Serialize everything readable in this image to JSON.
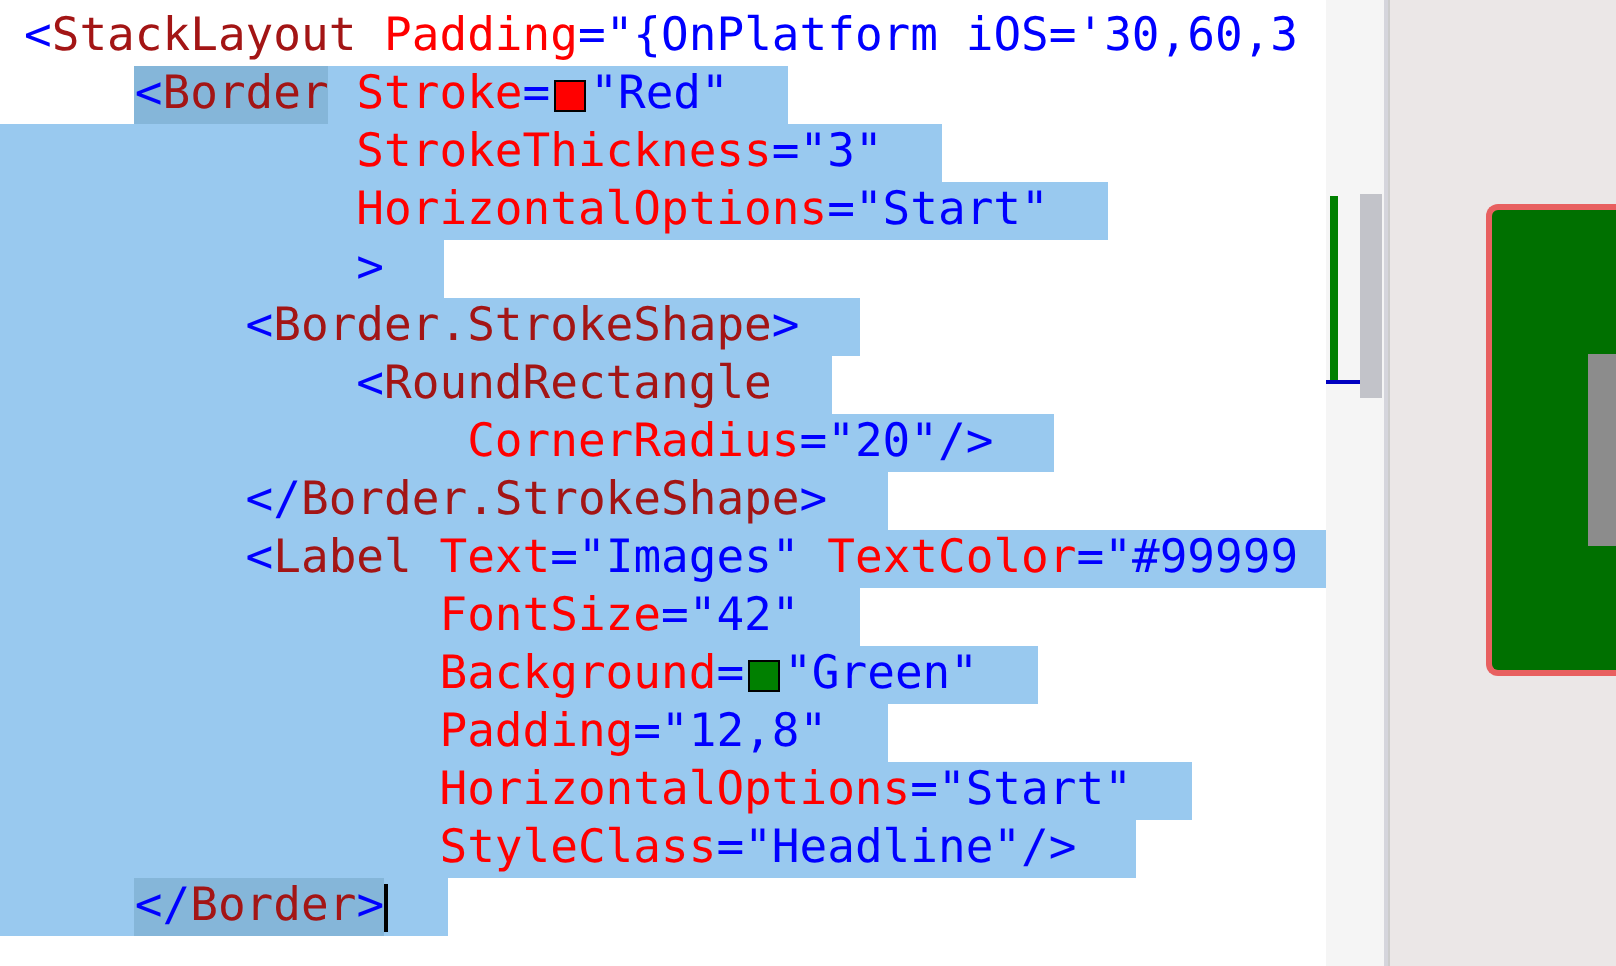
{
  "editor": {
    "lines": [
      {
        "selected": false,
        "tokens": [
          {
            "kind": "punct",
            "text": "<"
          },
          {
            "kind": "tag",
            "text": "StackLayout"
          },
          {
            "kind": "attr",
            "text": " Padding"
          },
          {
            "kind": "punct",
            "text": "="
          },
          {
            "kind": "value",
            "text": "\"{OnPlatform iOS='30,60,3"
          }
        ]
      },
      {
        "selected": true,
        "indent_selected": false,
        "tokens": [
          {
            "kind": "punct",
            "text": "    <",
            "matched": true
          },
          {
            "kind": "tag",
            "text": "Border",
            "matched": true
          },
          {
            "kind": "attr",
            "text": " Stroke"
          },
          {
            "kind": "punct",
            "text": "="
          },
          {
            "kind": "swatch",
            "color": "#ff0000"
          },
          {
            "kind": "value",
            "text": "\"Red\""
          }
        ]
      },
      {
        "selected": true,
        "indent_selected": true,
        "tokens": [
          {
            "kind": "attr",
            "text": "            StrokeThickness"
          },
          {
            "kind": "punct",
            "text": "="
          },
          {
            "kind": "value",
            "text": "\"3\""
          }
        ]
      },
      {
        "selected": true,
        "indent_selected": true,
        "tokens": [
          {
            "kind": "attr",
            "text": "            HorizontalOptions"
          },
          {
            "kind": "punct",
            "text": "="
          },
          {
            "kind": "value",
            "text": "\"Start\""
          }
        ]
      },
      {
        "selected": true,
        "indent_selected": true,
        "tokens": [
          {
            "kind": "punct",
            "text": "            >"
          }
        ]
      },
      {
        "selected": true,
        "indent_selected": true,
        "tokens": [
          {
            "kind": "punct",
            "text": "        <"
          },
          {
            "kind": "tag",
            "text": "Border.StrokeShape"
          },
          {
            "kind": "punct",
            "text": ">"
          }
        ]
      },
      {
        "selected": true,
        "indent_selected": true,
        "tokens": [
          {
            "kind": "punct",
            "text": "            <"
          },
          {
            "kind": "tag",
            "text": "RoundRectangle"
          }
        ]
      },
      {
        "selected": true,
        "indent_selected": true,
        "tokens": [
          {
            "kind": "attr",
            "text": "                CornerRadius"
          },
          {
            "kind": "punct",
            "text": "="
          },
          {
            "kind": "value",
            "text": "\"20\""
          },
          {
            "kind": "punct",
            "text": "/>"
          }
        ]
      },
      {
        "selected": true,
        "indent_selected": true,
        "tokens": [
          {
            "kind": "punct",
            "text": "        </"
          },
          {
            "kind": "tag",
            "text": "Border.StrokeShape"
          },
          {
            "kind": "punct",
            "text": ">"
          }
        ]
      },
      {
        "selected": true,
        "indent_selected": true,
        "tokens": [
          {
            "kind": "punct",
            "text": "        <"
          },
          {
            "kind": "tag",
            "text": "Label"
          },
          {
            "kind": "attr",
            "text": " Text"
          },
          {
            "kind": "punct",
            "text": "="
          },
          {
            "kind": "value",
            "text": "\"Images\""
          },
          {
            "kind": "attr",
            "text": " TextColor"
          },
          {
            "kind": "punct",
            "text": "="
          },
          {
            "kind": "value",
            "text": "\"#99999"
          }
        ]
      },
      {
        "selected": true,
        "indent_selected": true,
        "tokens": [
          {
            "kind": "attr",
            "text": "               FontSize"
          },
          {
            "kind": "punct",
            "text": "="
          },
          {
            "kind": "value",
            "text": "\"42\""
          }
        ]
      },
      {
        "selected": true,
        "indent_selected": true,
        "tokens": [
          {
            "kind": "attr",
            "text": "               Background"
          },
          {
            "kind": "punct",
            "text": "="
          },
          {
            "kind": "swatch",
            "color": "#008000"
          },
          {
            "kind": "value",
            "text": "\"Green\""
          }
        ]
      },
      {
        "selected": true,
        "indent_selected": true,
        "tokens": [
          {
            "kind": "attr",
            "text": "               Padding"
          },
          {
            "kind": "punct",
            "text": "="
          },
          {
            "kind": "value",
            "text": "\"12,8\""
          }
        ]
      },
      {
        "selected": true,
        "indent_selected": true,
        "tokens": [
          {
            "kind": "attr",
            "text": "               HorizontalOptions"
          },
          {
            "kind": "punct",
            "text": "="
          },
          {
            "kind": "value",
            "text": "\"Start\""
          }
        ]
      },
      {
        "selected": true,
        "indent_selected": true,
        "tokens": [
          {
            "kind": "attr",
            "text": "               StyleClass"
          },
          {
            "kind": "punct",
            "text": "="
          },
          {
            "kind": "value",
            "text": "\"Headline\""
          },
          {
            "kind": "punct",
            "text": "/>"
          }
        ]
      },
      {
        "selected": true,
        "indent_selected": true,
        "cursor": true,
        "tokens": [
          {
            "kind": "punct",
            "text": "    </",
            "matched": true
          },
          {
            "kind": "tag",
            "text": "Border",
            "matched": true
          },
          {
            "kind": "punct",
            "text": ">",
            "matched": true
          }
        ]
      }
    ]
  }
}
